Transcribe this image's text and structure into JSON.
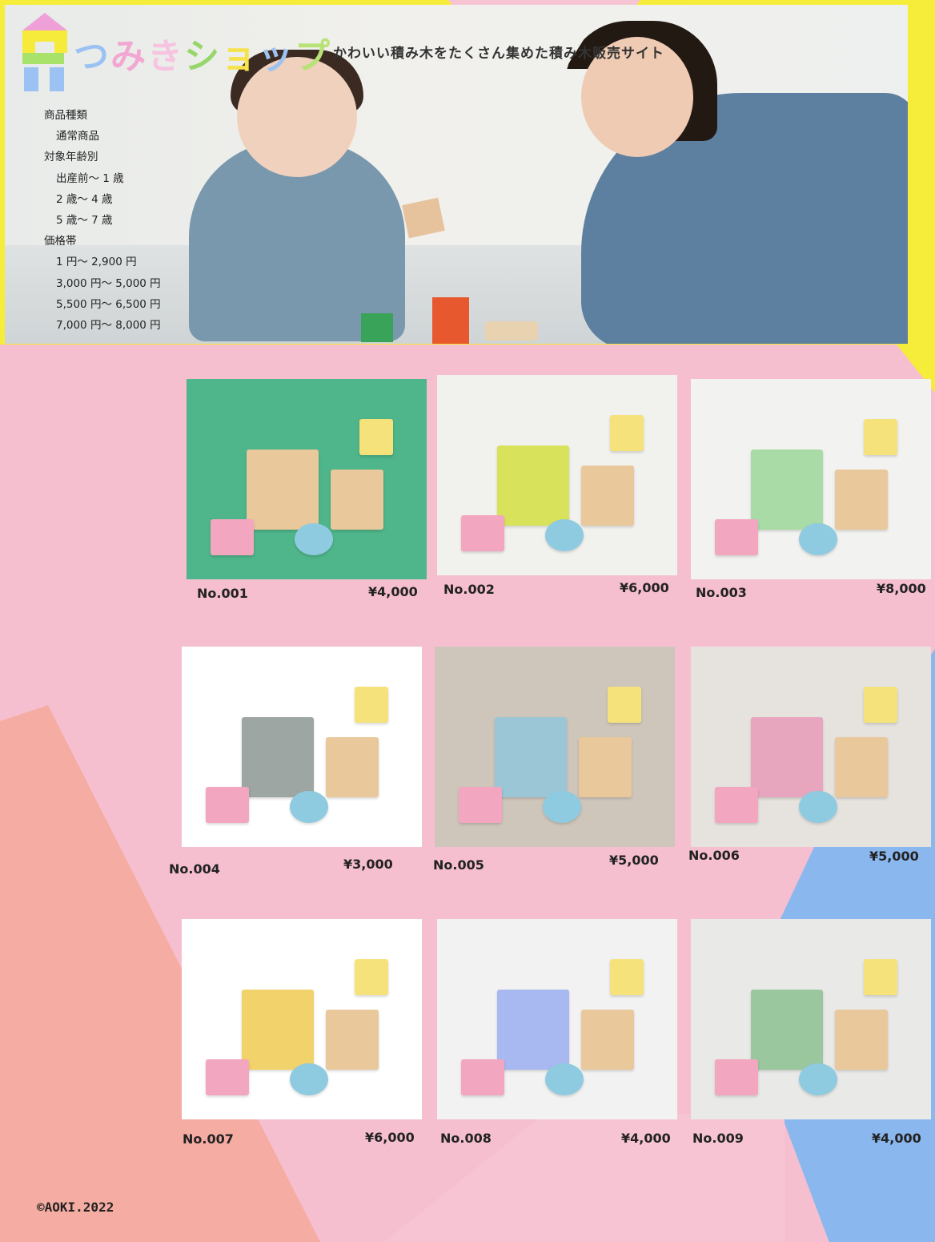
{
  "header": {
    "logo_text": "つみきショップ",
    "tagline": "かわいい積み木をたくさん集めた積み木販売サイト"
  },
  "sidebar": {
    "categories": [
      {
        "label": "商品種類",
        "items": [
          "通常商品"
        ]
      },
      {
        "label": "対象年齢別",
        "items": [
          "出産前〜 1 歳",
          "2 歳〜 4 歳",
          "5 歳〜 7 歳"
        ]
      },
      {
        "label": "価格帯",
        "items": [
          "1 円〜 2,900 円",
          "3,000 円〜 5,000 円",
          "5,500 円〜 6,500 円",
          "7,000 円〜 8,000 円"
        ]
      }
    ]
  },
  "products": [
    {
      "no": "No.001",
      "price": "¥4,000",
      "bg": "#4fb58a",
      "accent": "#e9c89b"
    },
    {
      "no": "No.002",
      "price": "¥6,000",
      "bg": "#f1f1ee",
      "accent": "#d8e25a"
    },
    {
      "no": "No.003",
      "price": "¥8,000",
      "bg": "#f2f2f0",
      "accent": "#a9dba6"
    },
    {
      "no": "No.004",
      "price": "¥3,000",
      "bg": "#ffffff",
      "accent": "#9ea6a3"
    },
    {
      "no": "No.005",
      "price": "¥5,000",
      "bg": "#cfc6bb",
      "accent": "#9bc6d6"
    },
    {
      "no": "No.006",
      "price": "¥5,000",
      "bg": "#e6e3df",
      "accent": "#e7a6bd"
    },
    {
      "no": "No.007",
      "price": "¥6,000",
      "bg": "#ffffff",
      "accent": "#f2d26a"
    },
    {
      "no": "No.008",
      "price": "¥4,000",
      "bg": "#f2f2f2",
      "accent": "#a8b8f0"
    },
    {
      "no": "No.009",
      "price": "¥4,000",
      "bg": "#e9e9e8",
      "accent": "#9bc79e"
    }
  ],
  "footer": {
    "copyright": "©AOKI.2022"
  }
}
